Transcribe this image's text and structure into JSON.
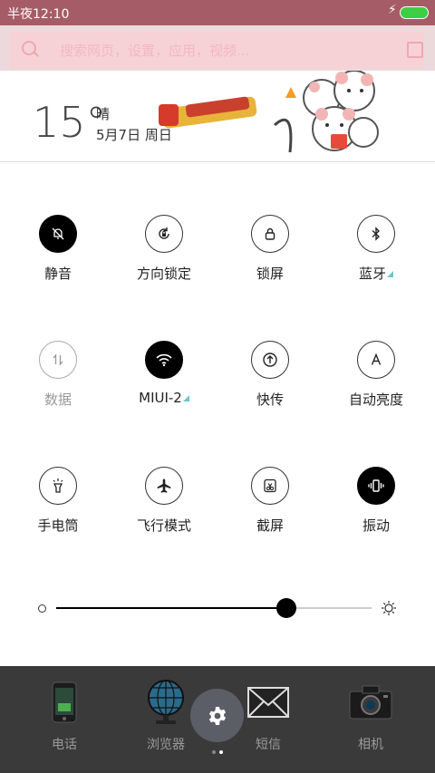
{
  "status_bar": {
    "time": "半夜12:10"
  },
  "search": {
    "placeholder": "搜索网页，设置，应用，视频..."
  },
  "weather": {
    "temperature": "15°",
    "condition": "晴",
    "date": "5月7日 周日"
  },
  "quick_settings": [
    {
      "label": "静音",
      "icon": "mute-bell-icon",
      "state": "on"
    },
    {
      "label": "方向锁定",
      "icon": "rotation-lock-icon",
      "state": "off"
    },
    {
      "label": "锁屏",
      "icon": "lock-icon",
      "state": "off"
    },
    {
      "label": "蓝牙",
      "icon": "bluetooth-icon",
      "state": "off",
      "expandable": true
    },
    {
      "label": "数据",
      "icon": "mobile-data-icon",
      "state": "disabled"
    },
    {
      "label": "MIUI-2",
      "icon": "wifi-icon",
      "state": "on",
      "expandable": true
    },
    {
      "label": "快传",
      "icon": "quick-transfer-icon",
      "state": "off"
    },
    {
      "label": "自动亮度",
      "icon": "auto-brightness-icon",
      "state": "off"
    },
    {
      "label": "手电筒",
      "icon": "flashlight-icon",
      "state": "off"
    },
    {
      "label": "飞行模式",
      "icon": "airplane-icon",
      "state": "off"
    },
    {
      "label": "截屏",
      "icon": "screenshot-icon",
      "state": "off"
    },
    {
      "label": "振动",
      "icon": "vibrate-icon",
      "state": "on"
    }
  ],
  "brightness": {
    "level": 0.73
  },
  "dock": [
    {
      "label": "电话",
      "icon": "phone-icon"
    },
    {
      "label": "浏览器",
      "icon": "globe-icon"
    },
    {
      "label": "短信",
      "icon": "envelope-icon"
    },
    {
      "label": "相机",
      "icon": "camera-icon"
    }
  ],
  "pager": {
    "pages": 2,
    "current": 2
  },
  "colors": {
    "status_bar": "#a65c66",
    "accent_triangle": "#6bc7c7",
    "dock": "#3a3a3a",
    "battery": "#3ccf44"
  }
}
